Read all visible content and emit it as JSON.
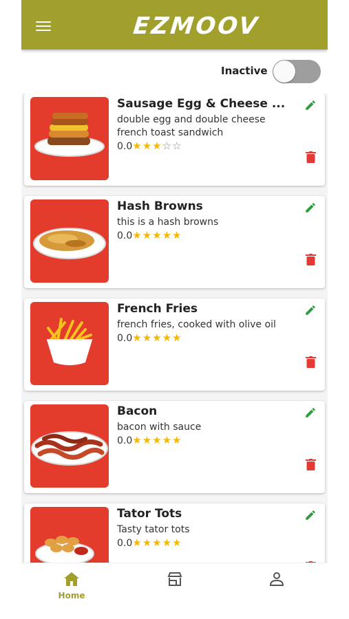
{
  "app": {
    "brand": "EZMOOV",
    "status_label": "Inactive",
    "accent_color": "#a2a02c"
  },
  "items": [
    {
      "title": "Sausage Egg & Cheese ...",
      "description": "double egg and double cheese french toast sandwich",
      "rating_text": "0.0",
      "stars_filled": 3,
      "stars_empty": 2
    },
    {
      "title": "Hash Browns",
      "description": "this is a hash browns",
      "rating_text": "0.0",
      "stars_filled": 5,
      "stars_empty": 0
    },
    {
      "title": "French Fries",
      "description": "french fries, cooked with olive oil",
      "rating_text": "0.0",
      "stars_filled": 5,
      "stars_empty": 0
    },
    {
      "title": "Bacon",
      "description": "bacon with sauce",
      "rating_text": "0.0",
      "stars_filled": 5,
      "stars_empty": 0
    },
    {
      "title": "Tator Tots",
      "description": "Tasty tator tots",
      "rating_text": "0.0",
      "stars_filled": 5,
      "stars_empty": 0
    }
  ],
  "nav": {
    "home_label": "Home",
    "icons": [
      "home-icon",
      "store-icon",
      "person-icon"
    ]
  }
}
